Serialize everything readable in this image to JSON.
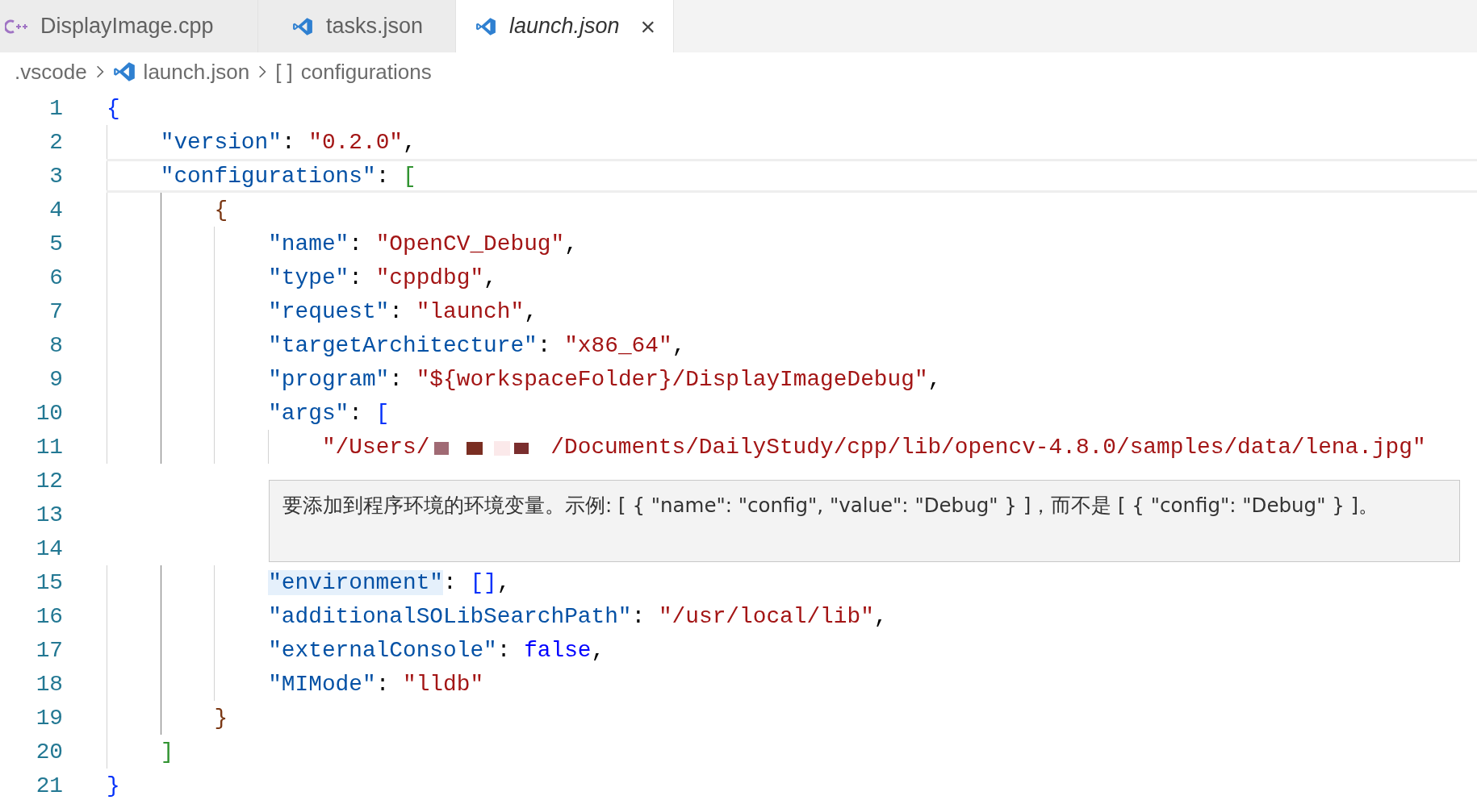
{
  "tabs": [
    {
      "label": "DisplayImage.cpp",
      "kind": "cpp",
      "selected": false,
      "italic": false
    },
    {
      "label": "tasks.json",
      "kind": "json",
      "selected": false,
      "italic": false
    },
    {
      "label": "launch.json",
      "kind": "json",
      "selected": true,
      "italic": true,
      "close": "×"
    }
  ],
  "breadcrumb": {
    "folder": ".vscode",
    "file": "launch.json",
    "symbol_icon": "[ ]",
    "symbol": "configurations"
  },
  "lines": [
    {
      "number": "1",
      "current": false,
      "tokens": [
        {
          "kind": "brace1",
          "text": "{"
        }
      ]
    },
    {
      "number": "2",
      "current": false,
      "tokens": [
        {
          "kind": "key",
          "text": "    \"version\""
        },
        {
          "kind": "punct",
          "text": ": "
        },
        {
          "kind": "string",
          "text": "\"0.2.0\""
        },
        {
          "kind": "punct",
          "text": ","
        }
      ]
    },
    {
      "number": "3",
      "current": true,
      "tokens": [
        {
          "kind": "key",
          "text": "    \"configurations\""
        },
        {
          "kind": "punct",
          "text": ": "
        },
        {
          "kind": "brace2",
          "text": "["
        }
      ]
    },
    {
      "number": "4",
      "current": false,
      "tokens": [
        {
          "kind": "brace3",
          "text": "        {"
        }
      ]
    },
    {
      "number": "5",
      "current": false,
      "tokens": [
        {
          "kind": "key",
          "text": "            \"name\""
        },
        {
          "kind": "punct",
          "text": ": "
        },
        {
          "kind": "string",
          "text": "\"OpenCV_Debug\""
        },
        {
          "kind": "punct",
          "text": ","
        }
      ]
    },
    {
      "number": "6",
      "current": false,
      "tokens": [
        {
          "kind": "key",
          "text": "            \"type\""
        },
        {
          "kind": "punct",
          "text": ": "
        },
        {
          "kind": "string",
          "text": "\"cppdbg\""
        },
        {
          "kind": "punct",
          "text": ","
        }
      ]
    },
    {
      "number": "7",
      "current": false,
      "tokens": [
        {
          "kind": "key",
          "text": "            \"request\""
        },
        {
          "kind": "punct",
          "text": ": "
        },
        {
          "kind": "string",
          "text": "\"launch\""
        },
        {
          "kind": "punct",
          "text": ","
        }
      ]
    },
    {
      "number": "8",
      "current": false,
      "tokens": [
        {
          "kind": "key",
          "text": "            \"targetArchitecture\""
        },
        {
          "kind": "punct",
          "text": ": "
        },
        {
          "kind": "string",
          "text": "\"x86_64\""
        },
        {
          "kind": "punct",
          "text": ","
        }
      ]
    },
    {
      "number": "9",
      "current": false,
      "tokens": [
        {
          "kind": "key",
          "text": "            \"program\""
        },
        {
          "kind": "punct",
          "text": ": "
        },
        {
          "kind": "string",
          "text": "\"${workspaceFolder}/DisplayImageDebug\""
        },
        {
          "kind": "punct",
          "text": ","
        }
      ]
    },
    {
      "number": "10",
      "current": false,
      "tokens": [
        {
          "kind": "key",
          "text": "            \"args\""
        },
        {
          "kind": "punct",
          "text": ": "
        },
        {
          "kind": "brace1",
          "text": "["
        }
      ]
    },
    {
      "number": "11",
      "current": false,
      "tokens": [
        {
          "kind": "string",
          "text": "                \"/Users/"
        },
        {
          "kind": "redacted"
        },
        {
          "kind": "string",
          "text": "/Documents/DailyStudy/cpp/lib/opencv-4.8.0/samples/data/lena.jpg\""
        }
      ]
    },
    {
      "number": "12",
      "current": false
    },
    {
      "number": "13",
      "current": false
    },
    {
      "number": "14",
      "current": false
    },
    {
      "number": "15",
      "current": false,
      "tokens": [
        {
          "kind": "key-hover",
          "text": "            \"environment\""
        },
        {
          "kind": "punct",
          "text": ": "
        },
        {
          "kind": "brace1",
          "text": "[]"
        },
        {
          "kind": "punct",
          "text": ","
        }
      ]
    },
    {
      "number": "16",
      "current": false,
      "tokens": [
        {
          "kind": "key",
          "text": "            \"additionalSOLibSearchPath\""
        },
        {
          "kind": "punct",
          "text": ": "
        },
        {
          "kind": "string",
          "text": "\"/usr/local/lib\""
        },
        {
          "kind": "punct",
          "text": ","
        }
      ]
    },
    {
      "number": "17",
      "current": false,
      "tokens": [
        {
          "kind": "key",
          "text": "            \"externalConsole\""
        },
        {
          "kind": "punct",
          "text": ": "
        },
        {
          "kind": "keyword",
          "text": "false"
        },
        {
          "kind": "punct",
          "text": ","
        }
      ]
    },
    {
      "number": "18",
      "current": false,
      "tokens": [
        {
          "kind": "key",
          "text": "            \"MIMode\""
        },
        {
          "kind": "punct",
          "text": ": "
        },
        {
          "kind": "string",
          "text": "\"lldb\""
        }
      ]
    },
    {
      "number": "19",
      "current": false,
      "tokens": [
        {
          "kind": "brace3",
          "text": "        }"
        }
      ]
    },
    {
      "number": "20",
      "current": false,
      "tokens": [
        {
          "kind": "brace2",
          "text": "    ]"
        }
      ]
    },
    {
      "number": "21",
      "current": false,
      "tokens": [
        {
          "kind": "brace1",
          "text": "}"
        }
      ]
    }
  ],
  "hover_tooltip": {
    "text": "要添加到程序环境的环境变量。示例: [ { \"name\": \"config\", \"value\": \"Debug\" } ]，而不是 [ { \"config\": \"Debug\" } ]。"
  }
}
